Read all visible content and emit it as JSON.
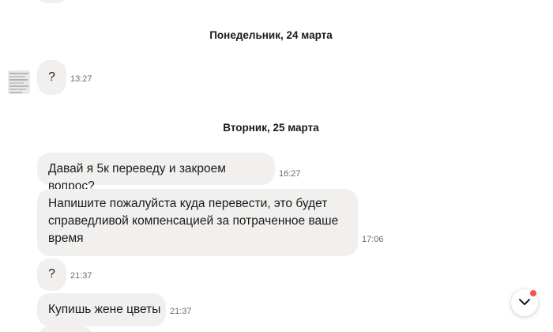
{
  "separators": [
    {
      "label": "Понедельник, 24 марта"
    },
    {
      "label": "Вторник, 25 марта"
    }
  ],
  "messages": [
    {
      "text": "?",
      "time": "13:27"
    },
    {
      "text": "Давай я 5к переведу и закроем вопрос?",
      "time": "16:27"
    },
    {
      "text": "Напишите пожалуйста куда перевести, это будет справедливой компенсацией за потраченное ваше время",
      "time": "17:06"
    },
    {
      "text": "?",
      "time": "21:37"
    },
    {
      "text": "Купишь жене цветы",
      "time": "21:37"
    }
  ],
  "scroll_button": {
    "icon": "chevron-down-icon",
    "badge_color": "#f0524f"
  },
  "colors": {
    "bubble_bg": "#f1f0ef",
    "time_text": "#6b6b6b"
  }
}
